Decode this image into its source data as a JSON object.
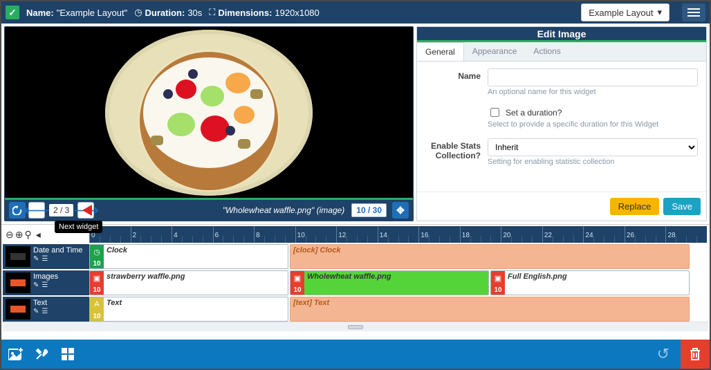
{
  "topbar": {
    "name_label": "Name:",
    "name_value": "\"Example Layout\"",
    "duration_label": "Duration:",
    "duration_value": "30s",
    "dimensions_label": "Dimensions:",
    "dimensions_value": "1920x1080",
    "layout_dropdown": "Example Layout"
  },
  "preview": {
    "page_indicator": "2 / 3",
    "file_label": "\"Wholewheat waffle.png\" (image)",
    "item_count": "10 / 30",
    "tooltip": "Next widget"
  },
  "edit_panel": {
    "title": "Edit Image",
    "tabs": {
      "general": "General",
      "appearance": "Appearance",
      "actions": "Actions"
    },
    "name_label": "Name",
    "name_hint": "An optional name for this widget",
    "name_value": "",
    "duration_checkbox": "Set a duration?",
    "duration_hint": "Select to provide a specific duration for this Widget",
    "stats_label": "Enable Stats Collection?",
    "stats_value": "Inherit",
    "stats_hint": "Setting for enabling statistic collection",
    "replace": "Replace",
    "save": "Save"
  },
  "timeline": {
    "ticks": [
      0,
      2,
      4,
      6,
      8,
      10,
      12,
      14,
      16,
      18,
      20,
      22,
      24,
      26,
      28
    ],
    "tracks": [
      {
        "name": "Date and Time",
        "swatch": "#333333",
        "clips": [
          {
            "label": "Clock",
            "badge_color": "#1aa34a",
            "badge_icon": "◷",
            "dur": "10",
            "start": 0,
            "len": 10
          }
        ],
        "ext": {
          "label": "[clock] Clock",
          "start": 10,
          "len": 20
        }
      },
      {
        "name": "Images",
        "swatch": "#e8562a",
        "clips": [
          {
            "label": "strawberry waffle.png",
            "badge_color": "#e63e2d",
            "badge_icon": "▣",
            "dur": "10",
            "start": 0,
            "len": 10,
            "bg": "#fff"
          },
          {
            "label": "Wholewheat waffle.png",
            "badge_color": "#e63e2d",
            "badge_icon": "▣",
            "dur": "10",
            "start": 10,
            "len": 10,
            "bg": "#55d43a"
          },
          {
            "label": "Full English.png",
            "badge_color": "#e63e2d",
            "badge_icon": "▣",
            "dur": "10",
            "start": 20,
            "len": 10,
            "bg": "#fff"
          }
        ]
      },
      {
        "name": "Text",
        "swatch": "#e8562a",
        "clips": [
          {
            "label": "Text",
            "badge_color": "#d9c23a",
            "badge_icon": "A",
            "dur": "10",
            "start": 0,
            "len": 10
          }
        ],
        "ext": {
          "label": "[text] Text",
          "start": 10,
          "len": 20
        }
      }
    ]
  }
}
